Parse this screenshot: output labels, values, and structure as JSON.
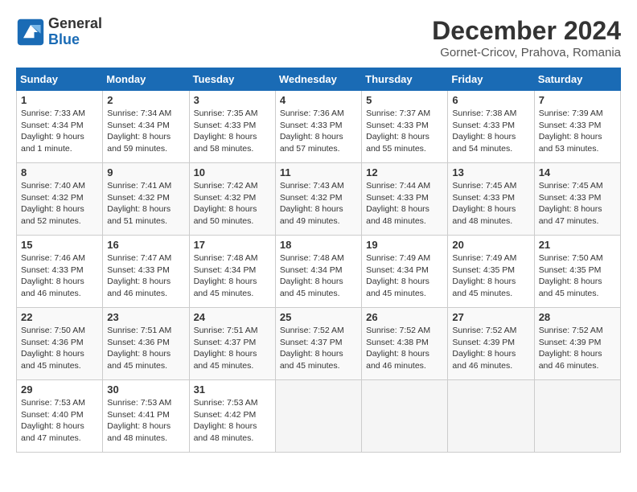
{
  "header": {
    "logo_line1": "General",
    "logo_line2": "Blue",
    "title": "December 2024",
    "subtitle": "Gornet-Cricov, Prahova, Romania"
  },
  "days_of_week": [
    "Sunday",
    "Monday",
    "Tuesday",
    "Wednesday",
    "Thursday",
    "Friday",
    "Saturday"
  ],
  "weeks": [
    [
      {
        "day": "1",
        "info": "Sunrise: 7:33 AM\nSunset: 4:34 PM\nDaylight: 9 hours and 1 minute."
      },
      {
        "day": "2",
        "info": "Sunrise: 7:34 AM\nSunset: 4:34 PM\nDaylight: 8 hours and 59 minutes."
      },
      {
        "day": "3",
        "info": "Sunrise: 7:35 AM\nSunset: 4:33 PM\nDaylight: 8 hours and 58 minutes."
      },
      {
        "day": "4",
        "info": "Sunrise: 7:36 AM\nSunset: 4:33 PM\nDaylight: 8 hours and 57 minutes."
      },
      {
        "day": "5",
        "info": "Sunrise: 7:37 AM\nSunset: 4:33 PM\nDaylight: 8 hours and 55 minutes."
      },
      {
        "day": "6",
        "info": "Sunrise: 7:38 AM\nSunset: 4:33 PM\nDaylight: 8 hours and 54 minutes."
      },
      {
        "day": "7",
        "info": "Sunrise: 7:39 AM\nSunset: 4:33 PM\nDaylight: 8 hours and 53 minutes."
      }
    ],
    [
      {
        "day": "8",
        "info": "Sunrise: 7:40 AM\nSunset: 4:32 PM\nDaylight: 8 hours and 52 minutes."
      },
      {
        "day": "9",
        "info": "Sunrise: 7:41 AM\nSunset: 4:32 PM\nDaylight: 8 hours and 51 minutes."
      },
      {
        "day": "10",
        "info": "Sunrise: 7:42 AM\nSunset: 4:32 PM\nDaylight: 8 hours and 50 minutes."
      },
      {
        "day": "11",
        "info": "Sunrise: 7:43 AM\nSunset: 4:32 PM\nDaylight: 8 hours and 49 minutes."
      },
      {
        "day": "12",
        "info": "Sunrise: 7:44 AM\nSunset: 4:33 PM\nDaylight: 8 hours and 48 minutes."
      },
      {
        "day": "13",
        "info": "Sunrise: 7:45 AM\nSunset: 4:33 PM\nDaylight: 8 hours and 48 minutes."
      },
      {
        "day": "14",
        "info": "Sunrise: 7:45 AM\nSunset: 4:33 PM\nDaylight: 8 hours and 47 minutes."
      }
    ],
    [
      {
        "day": "15",
        "info": "Sunrise: 7:46 AM\nSunset: 4:33 PM\nDaylight: 8 hours and 46 minutes."
      },
      {
        "day": "16",
        "info": "Sunrise: 7:47 AM\nSunset: 4:33 PM\nDaylight: 8 hours and 46 minutes."
      },
      {
        "day": "17",
        "info": "Sunrise: 7:48 AM\nSunset: 4:34 PM\nDaylight: 8 hours and 45 minutes."
      },
      {
        "day": "18",
        "info": "Sunrise: 7:48 AM\nSunset: 4:34 PM\nDaylight: 8 hours and 45 minutes."
      },
      {
        "day": "19",
        "info": "Sunrise: 7:49 AM\nSunset: 4:34 PM\nDaylight: 8 hours and 45 minutes."
      },
      {
        "day": "20",
        "info": "Sunrise: 7:49 AM\nSunset: 4:35 PM\nDaylight: 8 hours and 45 minutes."
      },
      {
        "day": "21",
        "info": "Sunrise: 7:50 AM\nSunset: 4:35 PM\nDaylight: 8 hours and 45 minutes."
      }
    ],
    [
      {
        "day": "22",
        "info": "Sunrise: 7:50 AM\nSunset: 4:36 PM\nDaylight: 8 hours and 45 minutes."
      },
      {
        "day": "23",
        "info": "Sunrise: 7:51 AM\nSunset: 4:36 PM\nDaylight: 8 hours and 45 minutes."
      },
      {
        "day": "24",
        "info": "Sunrise: 7:51 AM\nSunset: 4:37 PM\nDaylight: 8 hours and 45 minutes."
      },
      {
        "day": "25",
        "info": "Sunrise: 7:52 AM\nSunset: 4:37 PM\nDaylight: 8 hours and 45 minutes."
      },
      {
        "day": "26",
        "info": "Sunrise: 7:52 AM\nSunset: 4:38 PM\nDaylight: 8 hours and 46 minutes."
      },
      {
        "day": "27",
        "info": "Sunrise: 7:52 AM\nSunset: 4:39 PM\nDaylight: 8 hours and 46 minutes."
      },
      {
        "day": "28",
        "info": "Sunrise: 7:52 AM\nSunset: 4:39 PM\nDaylight: 8 hours and 46 minutes."
      }
    ],
    [
      {
        "day": "29",
        "info": "Sunrise: 7:53 AM\nSunset: 4:40 PM\nDaylight: 8 hours and 47 minutes."
      },
      {
        "day": "30",
        "info": "Sunrise: 7:53 AM\nSunset: 4:41 PM\nDaylight: 8 hours and 48 minutes."
      },
      {
        "day": "31",
        "info": "Sunrise: 7:53 AM\nSunset: 4:42 PM\nDaylight: 8 hours and 48 minutes."
      },
      null,
      null,
      null,
      null
    ]
  ]
}
